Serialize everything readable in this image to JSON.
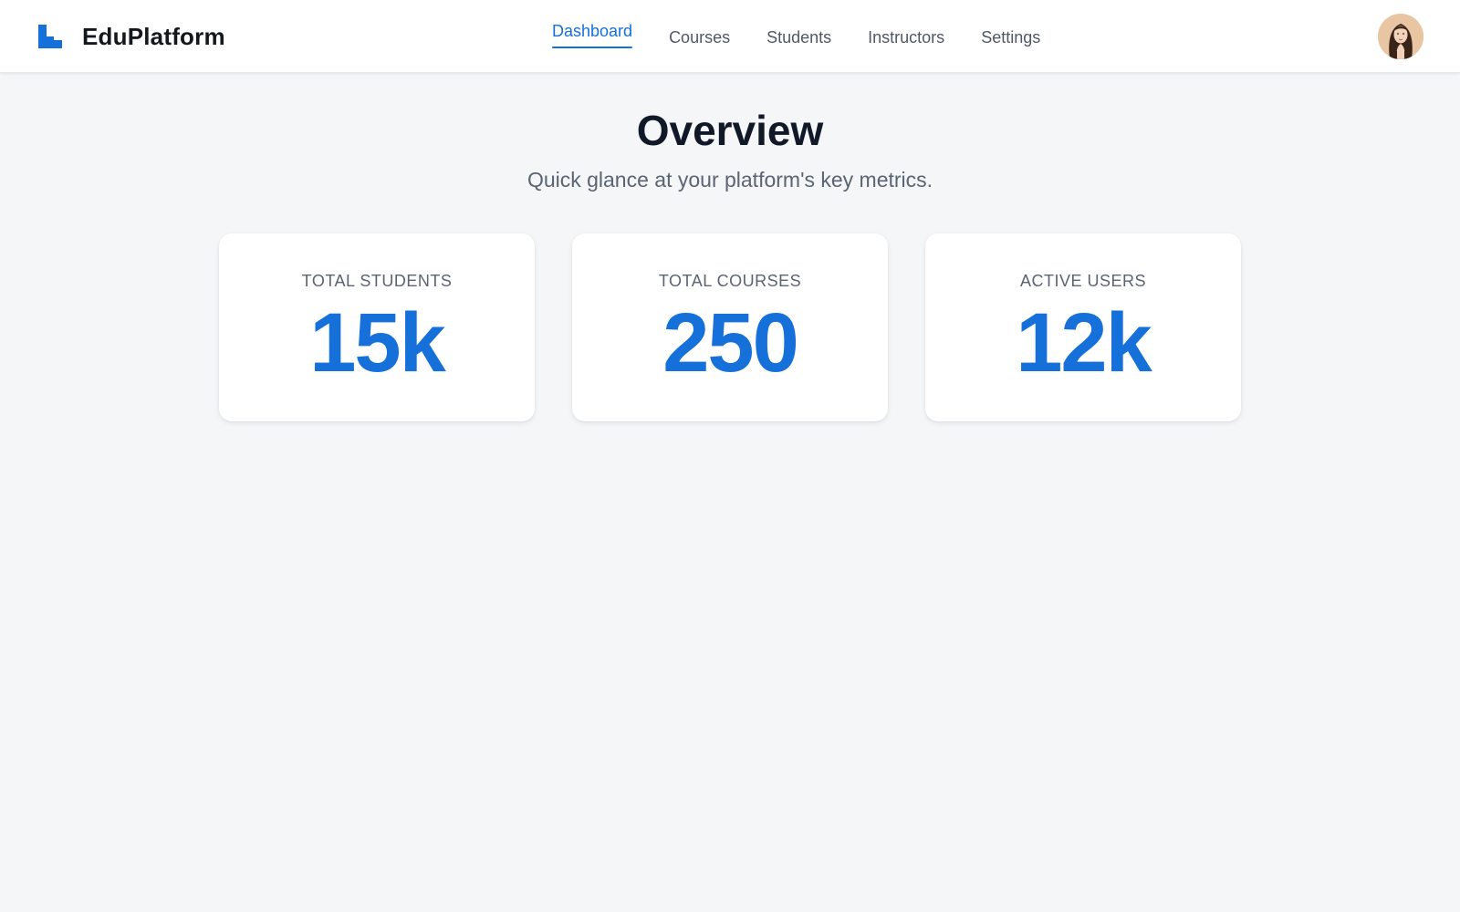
{
  "brand": {
    "name": "EduPlatform",
    "logo_icon": "stairs-logo-icon",
    "color": "#1570d9"
  },
  "nav": {
    "items": [
      {
        "label": "Dashboard",
        "active": true
      },
      {
        "label": "Courses",
        "active": false
      },
      {
        "label": "Students",
        "active": false
      },
      {
        "label": "Instructors",
        "active": false
      },
      {
        "label": "Settings",
        "active": false
      }
    ],
    "active_color": "#1570d9"
  },
  "user": {
    "avatar_icon": "user-avatar"
  },
  "page": {
    "title": "Overview",
    "subtitle": "Quick glance at your platform's key metrics."
  },
  "metrics": [
    {
      "label": "TOTAL STUDENTS",
      "value": "15k"
    },
    {
      "label": "TOTAL COURSES",
      "value": "250"
    },
    {
      "label": "ACTIVE USERS",
      "value": "12k"
    }
  ],
  "colors": {
    "accent": "#1570d9",
    "background": "#f4f6f8",
    "card": "#ffffff"
  }
}
